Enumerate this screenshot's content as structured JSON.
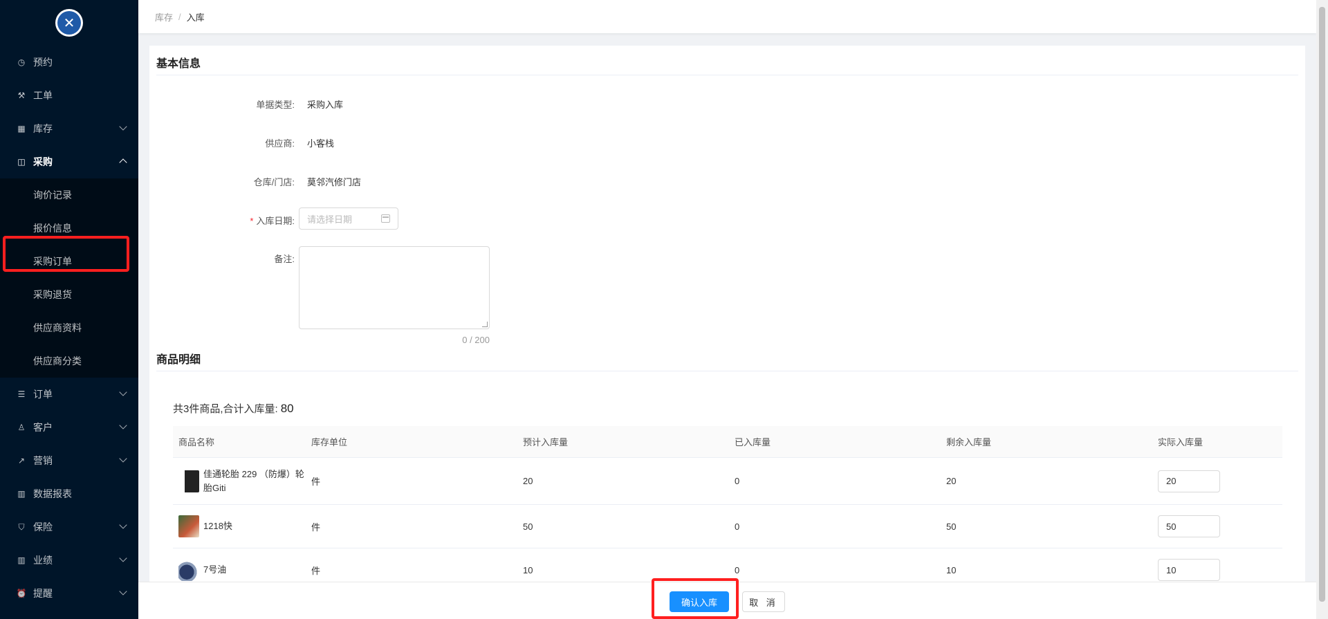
{
  "sidebar": {
    "logo_icon": "wrench-screwdriver-icon",
    "items": [
      {
        "label": "预约",
        "icon": "clock-icon",
        "glyph": "◷"
      },
      {
        "label": "工单",
        "icon": "wrench-icon",
        "glyph": "⚒"
      },
      {
        "label": "库存",
        "icon": "grid-icon",
        "glyph": "▦"
      },
      {
        "label": "采购",
        "icon": "bag-icon",
        "glyph": "◫"
      },
      {
        "label": "订单",
        "icon": "list-icon",
        "glyph": "☰"
      },
      {
        "label": "客户",
        "icon": "user-icon",
        "glyph": "♙"
      },
      {
        "label": "营销",
        "icon": "trend-icon",
        "glyph": "↗"
      },
      {
        "label": "数据报表",
        "icon": "bar-chart-icon",
        "glyph": "▥"
      },
      {
        "label": "保险",
        "icon": "shield-icon",
        "glyph": "⛉"
      },
      {
        "label": "业绩",
        "icon": "bar-chart-icon",
        "glyph": "▥"
      },
      {
        "label": "提醒",
        "icon": "alarm-icon",
        "glyph": "⏰"
      }
    ],
    "purchase_sub": [
      "询价记录",
      "报价信息",
      "采购订单",
      "采购退货",
      "供应商资料",
      "供应商分类"
    ]
  },
  "breadcrumb": {
    "parent": "库存",
    "sep": "/",
    "current": "入库"
  },
  "basic": {
    "title": "基本信息",
    "doc_type_label": "单据类型:",
    "doc_type_value": "采购入库",
    "supplier_label": "供应商:",
    "supplier_value": "小客栈",
    "warehouse_label": "仓库/门店:",
    "warehouse_value": "莫邻汽修门店",
    "date_required": "*",
    "date_label": "入库日期:",
    "date_placeholder": "请选择日期",
    "remark_label": "备注:",
    "remark_counter": "0 / 200"
  },
  "goods": {
    "title": "商品明细",
    "summary_text": "共3件商品,合计入库量:",
    "summary_total": "80",
    "columns": [
      "商品名称",
      "库存单位",
      "预计入库量",
      "已入库量",
      "剩余入库量",
      "实际入库量"
    ],
    "rows": [
      {
        "name": "佳通轮胎 229 （防爆）轮胎Giti",
        "unit": "件",
        "expected": "20",
        "received": "0",
        "remaining": "20",
        "actual": "20"
      },
      {
        "name": "1218快",
        "unit": "件",
        "expected": "50",
        "received": "0",
        "remaining": "50",
        "actual": "50"
      },
      {
        "name": "7号油",
        "unit": "件",
        "expected": "10",
        "received": "0",
        "remaining": "10",
        "actual": "10"
      }
    ]
  },
  "actions": {
    "confirm": "确认入库",
    "cancel": "取 消"
  },
  "colors": {
    "sidebar_bg": "#001529",
    "primary": "#1890ff",
    "highlight": "#ff1f1f"
  }
}
